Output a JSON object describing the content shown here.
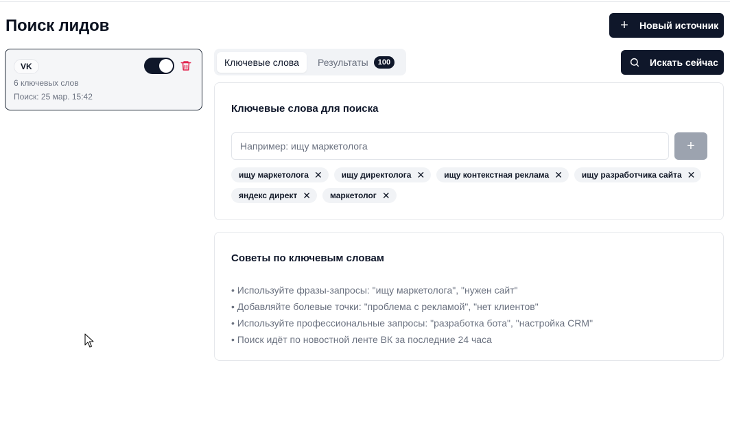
{
  "page": {
    "title": "Поиск лидов"
  },
  "header": {
    "new_source_label": "Новый источник",
    "search_now_label": "Искать сейчас"
  },
  "sources": [
    {
      "badge": "VK",
      "keywords_count": "6 ключевых слов",
      "last_search": "Поиск: 25 мар. 15:42",
      "enabled": true
    }
  ],
  "tabs": [
    {
      "label": "Ключевые слова",
      "active": true
    },
    {
      "label": "Результаты",
      "count": "100",
      "active": false
    }
  ],
  "keywords_panel": {
    "title": "Ключевые слова для поиска",
    "input_placeholder": "Например: ищу маркетолога",
    "input_value": "",
    "add_label": "+",
    "chips": [
      "ищу маркетолога",
      "ищу директолога",
      "ищу контекстная реклама",
      "ищу разработчика сайта",
      "яндекс директ",
      "маркетолог"
    ],
    "chip_remove_glyph": "✕"
  },
  "tips_panel": {
    "title": "Советы по ключевым словам",
    "items": [
      "• Используйте фразы-запросы: \"ищу маркетолога\", \"нужен сайт\"",
      "• Добавляйте болевые точки: \"проблема с рекламой\", \"нет клиентов\"",
      "• Используйте профессиональные запросы: \"разработка бота\", \"настройка CRM\"",
      "• Поиск идёт по новостной ленте ВК за последние 24 часа"
    ]
  },
  "colors": {
    "primary": "#0f172a",
    "danger": "#e11d48",
    "muted": "#6b7280",
    "border": "#e5e7eb",
    "surface": "#f1f3f6"
  },
  "icons": {
    "new_source": "plus-icon",
    "search": "search-icon",
    "delete": "trash-icon",
    "add_keyword": "plus-icon",
    "remove_chip": "close-icon"
  }
}
